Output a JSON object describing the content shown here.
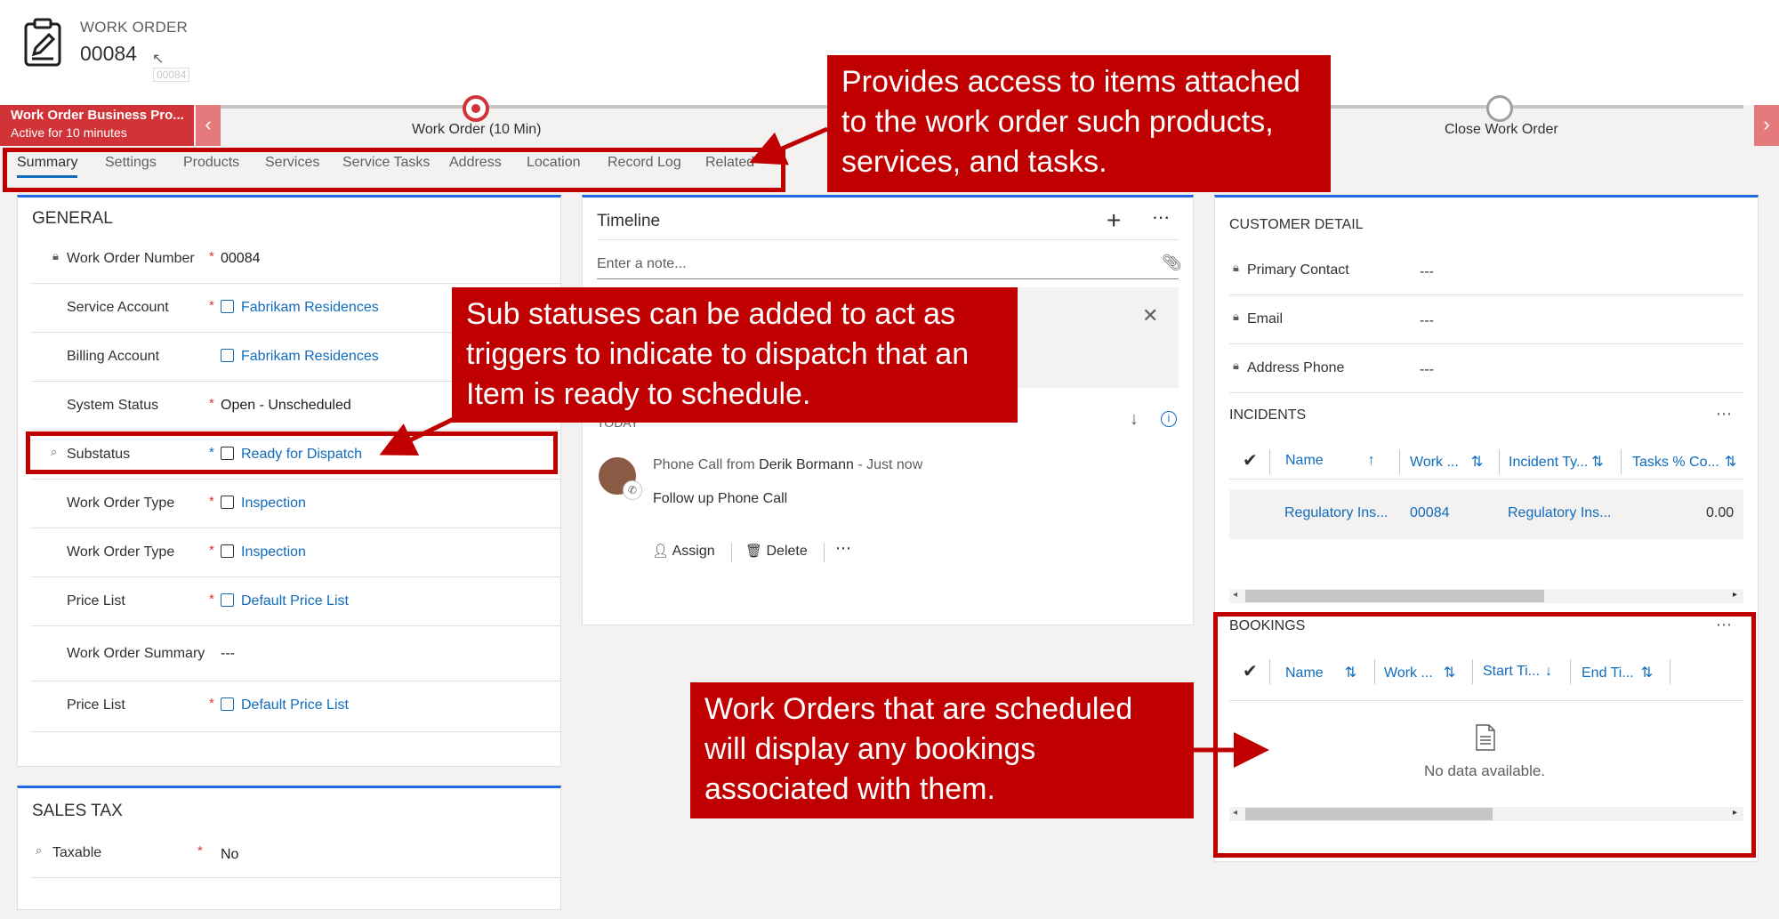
{
  "header": {
    "entity": "WORK ORDER",
    "number": "00084",
    "tooltip": "00084"
  },
  "process": {
    "name": "Work Order Business Pro...",
    "active": "Active for 10 minutes",
    "stage1": "Work Order  (10 Min)",
    "stage2": "Close Work Order"
  },
  "tabs": [
    "Summary",
    "Settings",
    "Products",
    "Services",
    "Service Tasks",
    "Address",
    "Location",
    "Record Log",
    "Related"
  ],
  "general": {
    "title": "GENERAL",
    "fields": [
      {
        "label": "Work Order Number",
        "value": "00084"
      },
      {
        "label": "Service Account",
        "value": "Fabrikam Residences"
      },
      {
        "label": "Billing Account",
        "value": "Fabrikam Residences"
      },
      {
        "label": "System Status",
        "value": "Open - Unscheduled"
      },
      {
        "label": "Substatus",
        "value": "Ready for Dispatch"
      },
      {
        "label": "Work Order Type",
        "value": "Inspection"
      },
      {
        "label": "Work Order Type",
        "value": "Inspection"
      },
      {
        "label": "Price List",
        "value": "Default Price List"
      },
      {
        "label": "Work Order Summary",
        "value": "---"
      },
      {
        "label": "Price List",
        "value": "Default Price List"
      }
    ]
  },
  "sales_tax": {
    "title": "SALES TAX",
    "label": "Taxable",
    "value": "No"
  },
  "timeline": {
    "title": "Timeline",
    "placeholder": "Enter a note...",
    "today": "TODAY",
    "activity_prefix": "Phone Call from",
    "activity_person": "Derik Bormann",
    "activity_sep": "-",
    "activity_time": "Just now",
    "activity_subject": "Follow up Phone Call",
    "assign": "Assign",
    "delete": "Delete"
  },
  "customer": {
    "title": "CUSTOMER DETAIL",
    "fields": [
      {
        "label": "Primary Contact",
        "value": "---"
      },
      {
        "label": "Email",
        "value": "---"
      },
      {
        "label": "Address Phone",
        "value": "---"
      }
    ]
  },
  "incidents": {
    "title": "INCIDENTS",
    "columns": [
      "Name",
      "Work ...",
      "Incident Ty...",
      "Tasks % Co..."
    ],
    "row": [
      "Regulatory Ins...",
      "00084",
      "Regulatory Ins...",
      "0.00"
    ]
  },
  "bookings": {
    "title": "BOOKINGS",
    "columns": [
      "Name",
      "Work ...",
      "Start Ti...",
      "End Ti..."
    ],
    "empty": "No data available."
  },
  "callouts": {
    "tabs": "Provides access to items attached to the work order such products, services, and tasks.",
    "substatus": "Sub statuses can be added to act as triggers to indicate to dispatch that an Item is ready to schedule.",
    "bookings": "Work Orders that are scheduled will display any bookings associated with them."
  },
  "colors": {
    "process_red": "#d13438",
    "callout_red": "#c00000",
    "link_blue": "#0f6cbd",
    "accent_blue": "#2266e3"
  },
  "icons": [
    "work-order-clipboard-icon",
    "lock-icon",
    "account-icon",
    "substatus-icon",
    "pricelist-icon",
    "plus-icon",
    "more-icon",
    "attach-icon",
    "close-icon",
    "sort-down-icon",
    "info-icon",
    "avatar",
    "phone-icon",
    "assign-icon",
    "delete-icon",
    "checkmark-icon",
    "document-icon"
  ]
}
